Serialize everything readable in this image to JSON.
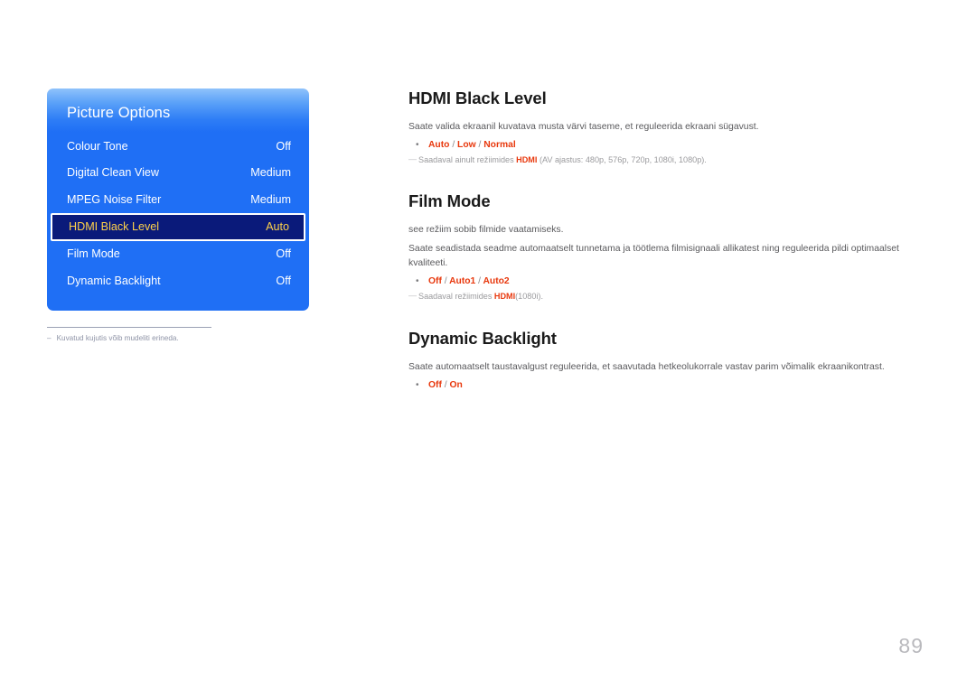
{
  "osd": {
    "title": "Picture Options",
    "rows": [
      {
        "label": "Colour Tone",
        "value": "Off",
        "selected": false
      },
      {
        "label": "Digital Clean View",
        "value": "Medium",
        "selected": false
      },
      {
        "label": "MPEG Noise Filter",
        "value": "Medium",
        "selected": false
      },
      {
        "label": "HDMI Black Level",
        "value": "Auto",
        "selected": true
      },
      {
        "label": "Film Mode",
        "value": "Off",
        "selected": false
      },
      {
        "label": "Dynamic Backlight",
        "value": "Off",
        "selected": false
      }
    ],
    "footnote_dash": "–",
    "footnote": "Kuvatud kujutis võib mudeliti erineda."
  },
  "sections": [
    {
      "heading": "HDMI Black Level",
      "paragraphs": [
        "Saate valida ekraanil kuvatava musta värvi taseme, et reguleerida ekraani sügavust."
      ],
      "bullet": "•",
      "options_prefix": "Auto",
      "options_rest": " / Low / Normal",
      "options_plain": "Auto / Low / Normal",
      "note_dash": "—",
      "note_before": "Saadaval ainult režiimides ",
      "note_highlight": "HDMI",
      "note_after": " (AV ajastus: 480p, 576p, 720p, 1080i, 1080p)."
    },
    {
      "heading": "Film Mode",
      "paragraphs": [
        "see režiim sobib filmide vaatamiseks.",
        "Saate seadistada seadme automaatselt tunnetama ja töötlema filmisignaali allikatest ning reguleerida pildi optimaalset kvaliteeti."
      ],
      "bullet": "•",
      "options_plain": "Off / Auto1 / Auto2",
      "note_dash": "—",
      "note_before": "Saadaval režiimides ",
      "note_highlight": "HDMI",
      "note_after": "(1080i)."
    },
    {
      "heading": "Dynamic Backlight",
      "paragraphs": [
        "Saate automaatselt taustavalgust reguleerida, et saavutada hetkeolukorrale vastav parim võimalik ekraanikontrast."
      ],
      "bullet": "•",
      "options_plain": "Off / On",
      "note_dash": "",
      "note_before": "",
      "note_highlight": "",
      "note_after": ""
    }
  ],
  "page_number": "89",
  "colors": {
    "osd_blue": "#1f6ff5",
    "osd_selected_bg": "#0a1a7a",
    "osd_selected_text": "#ffd24a",
    "accent_red": "#e8380d",
    "body_text": "#59595c",
    "note_text": "#9a9a9d",
    "page_number": "#b9b9bd"
  }
}
